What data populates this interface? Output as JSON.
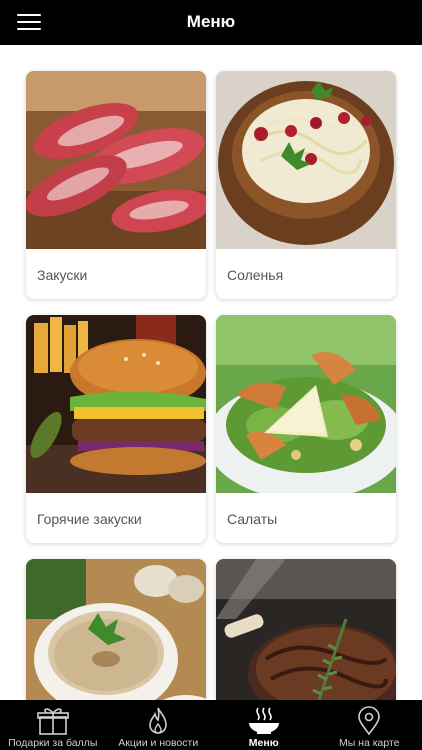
{
  "header": {
    "title": "Меню"
  },
  "categories": [
    {
      "label": "Закуски"
    },
    {
      "label": "Соленья"
    },
    {
      "label": "Горячие закуски"
    },
    {
      "label": "Салаты"
    },
    {
      "label": ""
    },
    {
      "label": ""
    }
  ],
  "tabbar": {
    "items": [
      {
        "label": "Подарки за баллы",
        "icon": "gift-icon",
        "active": false
      },
      {
        "label": "Акции и новости",
        "icon": "flame-icon",
        "active": false
      },
      {
        "label": "Меню",
        "icon": "dish-icon",
        "active": true
      },
      {
        "label": "Мы на карте",
        "icon": "map-pin-icon",
        "active": false
      }
    ]
  },
  "colors": {
    "bar_background": "#000000",
    "bar_text": "#ffffff",
    "card_label": "#555555"
  }
}
